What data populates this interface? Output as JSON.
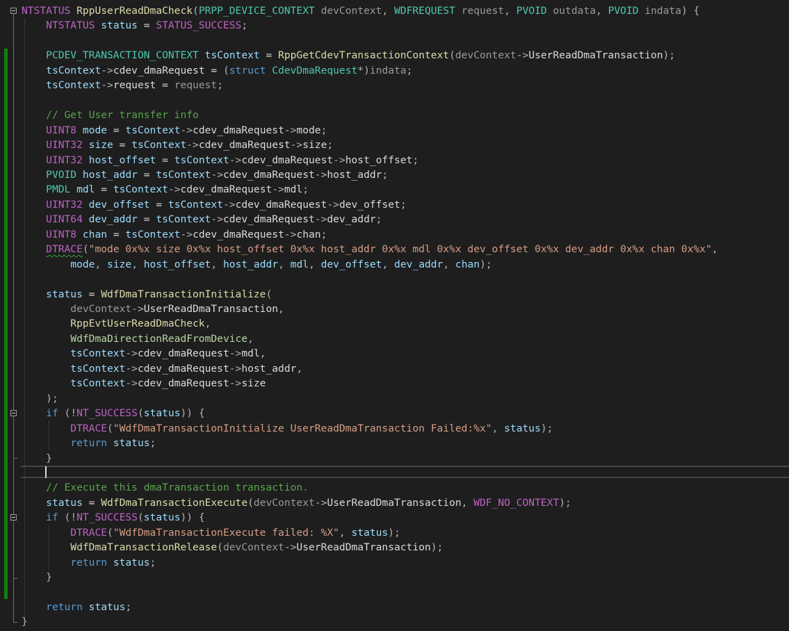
{
  "editor": {
    "colors": {
      "background": "#1e1e1e",
      "keyword": "#569cd6",
      "type": "#4ec9b0",
      "function": "#dcdcaa",
      "parameter": "#9a9a9a",
      "local": "#9cdcfe",
      "member": "#dadada",
      "string": "#d69d85",
      "comment": "#57a64a",
      "macro": "#bd63c5",
      "enum": "#b8d7a3",
      "changed_bar": "#108010"
    },
    "icons": [
      "fold-collapse-icon"
    ],
    "lines": [
      [
        [
          "ma",
          "NTSTATUS"
        ],
        [
          "tx",
          " "
        ],
        [
          "fn",
          "RppUserReadDmaCheck"
        ],
        [
          "op",
          "("
        ],
        [
          "ty",
          "PRPP_DEVICE_CONTEXT"
        ],
        [
          "tx",
          " "
        ],
        [
          "pa",
          "devContext"
        ],
        [
          "op",
          ", "
        ],
        [
          "ty",
          "WDFREQUEST"
        ],
        [
          "tx",
          " "
        ],
        [
          "pa",
          "request"
        ],
        [
          "op",
          ", "
        ],
        [
          "ty",
          "PVOID"
        ],
        [
          "tx",
          " "
        ],
        [
          "pa",
          "outdata"
        ],
        [
          "op",
          ", "
        ],
        [
          "ty",
          "PVOID"
        ],
        [
          "tx",
          " "
        ],
        [
          "pa",
          "indata"
        ],
        [
          "op",
          ") {"
        ]
      ],
      [
        [
          "tx",
          "    "
        ],
        [
          "ma",
          "NTSTATUS"
        ],
        [
          "tx",
          " "
        ],
        [
          "lv",
          "status"
        ],
        [
          "tx",
          " = "
        ],
        [
          "ma",
          "STATUS_SUCCESS"
        ],
        [
          "op",
          ";"
        ]
      ],
      [],
      [
        [
          "tx",
          "    "
        ],
        [
          "ty",
          "PCDEV_TRANSACTION_CONTEXT"
        ],
        [
          "tx",
          " "
        ],
        [
          "lv",
          "tsContext"
        ],
        [
          "tx",
          " = "
        ],
        [
          "fn",
          "RppGetCdevTransactionContext"
        ],
        [
          "op",
          "("
        ],
        [
          "pa",
          "devContext"
        ],
        [
          "op",
          "->"
        ],
        [
          "mb",
          "UserReadDmaTransaction"
        ],
        [
          "op",
          ");"
        ]
      ],
      [
        [
          "tx",
          "    "
        ],
        [
          "lv",
          "tsContext"
        ],
        [
          "op",
          "->"
        ],
        [
          "mb",
          "cdev_dmaRequest"
        ],
        [
          "tx",
          " = "
        ],
        [
          "op",
          "("
        ],
        [
          "kw",
          "struct"
        ],
        [
          "tx",
          " "
        ],
        [
          "ty",
          "CdevDmaRequest"
        ],
        [
          "op",
          "*)"
        ],
        [
          "pa",
          "indata"
        ],
        [
          "op",
          ";"
        ]
      ],
      [
        [
          "tx",
          "    "
        ],
        [
          "lv",
          "tsContext"
        ],
        [
          "op",
          "->"
        ],
        [
          "mb",
          "request"
        ],
        [
          "tx",
          " = "
        ],
        [
          "pa",
          "request"
        ],
        [
          "op",
          ";"
        ]
      ],
      [],
      [
        [
          "tx",
          "    "
        ],
        [
          "cm",
          "// Get User transfer info"
        ]
      ],
      [
        [
          "tx",
          "    "
        ],
        [
          "ma",
          "UINT8"
        ],
        [
          "tx",
          " "
        ],
        [
          "lv",
          "mode"
        ],
        [
          "tx",
          " = "
        ],
        [
          "lv",
          "tsContext"
        ],
        [
          "op",
          "->"
        ],
        [
          "mb",
          "cdev_dmaRequest"
        ],
        [
          "op",
          "->"
        ],
        [
          "mb",
          "mode"
        ],
        [
          "op",
          ";"
        ]
      ],
      [
        [
          "tx",
          "    "
        ],
        [
          "ma",
          "UINT32"
        ],
        [
          "tx",
          " "
        ],
        [
          "lv",
          "size"
        ],
        [
          "tx",
          " = "
        ],
        [
          "lv",
          "tsContext"
        ],
        [
          "op",
          "->"
        ],
        [
          "mb",
          "cdev_dmaRequest"
        ],
        [
          "op",
          "->"
        ],
        [
          "mb",
          "size"
        ],
        [
          "op",
          ";"
        ]
      ],
      [
        [
          "tx",
          "    "
        ],
        [
          "ma",
          "UINT32"
        ],
        [
          "tx",
          " "
        ],
        [
          "lv",
          "host_offset"
        ],
        [
          "tx",
          " = "
        ],
        [
          "lv",
          "tsContext"
        ],
        [
          "op",
          "->"
        ],
        [
          "mb",
          "cdev_dmaRequest"
        ],
        [
          "op",
          "->"
        ],
        [
          "mb",
          "host_offset"
        ],
        [
          "op",
          ";"
        ]
      ],
      [
        [
          "tx",
          "    "
        ],
        [
          "ty",
          "PVOID"
        ],
        [
          "tx",
          " "
        ],
        [
          "lv",
          "host_addr"
        ],
        [
          "tx",
          " = "
        ],
        [
          "lv",
          "tsContext"
        ],
        [
          "op",
          "->"
        ],
        [
          "mb",
          "cdev_dmaRequest"
        ],
        [
          "op",
          "->"
        ],
        [
          "mb",
          "host_addr"
        ],
        [
          "op",
          ";"
        ]
      ],
      [
        [
          "tx",
          "    "
        ],
        [
          "ty",
          "PMDL"
        ],
        [
          "tx",
          " "
        ],
        [
          "lv",
          "mdl"
        ],
        [
          "tx",
          " = "
        ],
        [
          "lv",
          "tsContext"
        ],
        [
          "op",
          "->"
        ],
        [
          "mb",
          "cdev_dmaRequest"
        ],
        [
          "op",
          "->"
        ],
        [
          "mb",
          "mdl"
        ],
        [
          "op",
          ";"
        ]
      ],
      [
        [
          "tx",
          "    "
        ],
        [
          "ma",
          "UINT32"
        ],
        [
          "tx",
          " "
        ],
        [
          "lv",
          "dev_offset"
        ],
        [
          "tx",
          " = "
        ],
        [
          "lv",
          "tsContext"
        ],
        [
          "op",
          "->"
        ],
        [
          "mb",
          "cdev_dmaRequest"
        ],
        [
          "op",
          "->"
        ],
        [
          "mb",
          "dev_offset"
        ],
        [
          "op",
          ";"
        ]
      ],
      [
        [
          "tx",
          "    "
        ],
        [
          "ma",
          "UINT64"
        ],
        [
          "tx",
          " "
        ],
        [
          "lv",
          "dev_addr"
        ],
        [
          "tx",
          " = "
        ],
        [
          "lv",
          "tsContext"
        ],
        [
          "op",
          "->"
        ],
        [
          "mb",
          "cdev_dmaRequest"
        ],
        [
          "op",
          "->"
        ],
        [
          "mb",
          "dev_addr"
        ],
        [
          "op",
          ";"
        ]
      ],
      [
        [
          "tx",
          "    "
        ],
        [
          "ma",
          "UINT8"
        ],
        [
          "tx",
          " "
        ],
        [
          "lv",
          "chan"
        ],
        [
          "tx",
          " = "
        ],
        [
          "lv",
          "tsContext"
        ],
        [
          "op",
          "->"
        ],
        [
          "mb",
          "cdev_dmaRequest"
        ],
        [
          "op",
          "->"
        ],
        [
          "mb",
          "chan"
        ],
        [
          "op",
          ";"
        ]
      ],
      [
        [
          "tx",
          "    "
        ],
        [
          "mq",
          "DTRACE"
        ],
        [
          "op",
          "("
        ],
        [
          "st",
          "\"mode 0x%x size 0x%x host_offset 0x%x host_addr 0x%x mdl 0x%x dev_offset 0x%x dev_addr 0x%x chan 0x%x\""
        ],
        [
          "op",
          ","
        ]
      ],
      [
        [
          "tx",
          "        "
        ],
        [
          "lv",
          "mode"
        ],
        [
          "op",
          ", "
        ],
        [
          "lv",
          "size"
        ],
        [
          "op",
          ", "
        ],
        [
          "lv",
          "host_offset"
        ],
        [
          "op",
          ", "
        ],
        [
          "lv",
          "host_addr"
        ],
        [
          "op",
          ", "
        ],
        [
          "lv",
          "mdl"
        ],
        [
          "op",
          ", "
        ],
        [
          "lv",
          "dev_offset"
        ],
        [
          "op",
          ", "
        ],
        [
          "lv",
          "dev_addr"
        ],
        [
          "op",
          ", "
        ],
        [
          "lv",
          "chan"
        ],
        [
          "op",
          ");"
        ]
      ],
      [],
      [
        [
          "tx",
          "    "
        ],
        [
          "lv",
          "status"
        ],
        [
          "tx",
          " = "
        ],
        [
          "fn",
          "WdfDmaTransactionInitialize"
        ],
        [
          "op",
          "("
        ]
      ],
      [
        [
          "tx",
          "        "
        ],
        [
          "pa",
          "devContext"
        ],
        [
          "op",
          "->"
        ],
        [
          "mb",
          "UserReadDmaTransaction"
        ],
        [
          "op",
          ","
        ]
      ],
      [
        [
          "tx",
          "        "
        ],
        [
          "fn",
          "RppEvtUserReadDmaCheck"
        ],
        [
          "op",
          ","
        ]
      ],
      [
        [
          "tx",
          "        "
        ],
        [
          "en",
          "WdfDmaDirectionReadFromDevice"
        ],
        [
          "op",
          ","
        ]
      ],
      [
        [
          "tx",
          "        "
        ],
        [
          "lv",
          "tsContext"
        ],
        [
          "op",
          "->"
        ],
        [
          "mb",
          "cdev_dmaRequest"
        ],
        [
          "op",
          "->"
        ],
        [
          "mb",
          "mdl"
        ],
        [
          "op",
          ","
        ]
      ],
      [
        [
          "tx",
          "        "
        ],
        [
          "lv",
          "tsContext"
        ],
        [
          "op",
          "->"
        ],
        [
          "mb",
          "cdev_dmaRequest"
        ],
        [
          "op",
          "->"
        ],
        [
          "mb",
          "host_addr"
        ],
        [
          "op",
          ","
        ]
      ],
      [
        [
          "tx",
          "        "
        ],
        [
          "lv",
          "tsContext"
        ],
        [
          "op",
          "->"
        ],
        [
          "mb",
          "cdev_dmaRequest"
        ],
        [
          "op",
          "->"
        ],
        [
          "mb",
          "size"
        ]
      ],
      [
        [
          "tx",
          "    "
        ],
        [
          "op",
          ");"
        ]
      ],
      [
        [
          "tx",
          "    "
        ],
        [
          "kw",
          "if"
        ],
        [
          "tx",
          " "
        ],
        [
          "op",
          "(!"
        ],
        [
          "ma",
          "NT_SUCCESS"
        ],
        [
          "op",
          "("
        ],
        [
          "lv",
          "status"
        ],
        [
          "op",
          "))"
        ],
        [
          "tx",
          " "
        ],
        [
          "op",
          "{"
        ]
      ],
      [
        [
          "tx",
          "        "
        ],
        [
          "ma",
          "DTRACE"
        ],
        [
          "op",
          "("
        ],
        [
          "st",
          "\"WdfDmaTransactionInitialize UserReadDmaTransaction Failed:%x\""
        ],
        [
          "op",
          ", "
        ],
        [
          "lv",
          "status"
        ],
        [
          "op",
          ");"
        ]
      ],
      [
        [
          "tx",
          "        "
        ],
        [
          "kw",
          "return"
        ],
        [
          "tx",
          " "
        ],
        [
          "lv",
          "status"
        ],
        [
          "op",
          ";"
        ]
      ],
      [
        [
          "tx",
          "    "
        ],
        [
          "op",
          "}"
        ]
      ],
      [],
      [
        [
          "tx",
          "    "
        ],
        [
          "cm",
          "// Execute this dmaTransaction transaction."
        ]
      ],
      [
        [
          "tx",
          "    "
        ],
        [
          "lv",
          "status"
        ],
        [
          "tx",
          " = "
        ],
        [
          "fn",
          "WdfDmaTransactionExecute"
        ],
        [
          "op",
          "("
        ],
        [
          "pa",
          "devContext"
        ],
        [
          "op",
          "->"
        ],
        [
          "mb",
          "UserReadDmaTransaction"
        ],
        [
          "op",
          ", "
        ],
        [
          "ma",
          "WDF_NO_CONTEXT"
        ],
        [
          "op",
          ");"
        ]
      ],
      [
        [
          "tx",
          "    "
        ],
        [
          "kw",
          "if"
        ],
        [
          "tx",
          " "
        ],
        [
          "op",
          "(!"
        ],
        [
          "ma",
          "NT_SUCCESS"
        ],
        [
          "op",
          "("
        ],
        [
          "lv",
          "status"
        ],
        [
          "op",
          "))"
        ],
        [
          "tx",
          " "
        ],
        [
          "op",
          "{"
        ]
      ],
      [
        [
          "tx",
          "        "
        ],
        [
          "ma",
          "DTRACE"
        ],
        [
          "op",
          "("
        ],
        [
          "st",
          "\"WdfDmaTransactionExecute failed: %X\""
        ],
        [
          "op",
          ", "
        ],
        [
          "lv",
          "status"
        ],
        [
          "op",
          ");"
        ]
      ],
      [
        [
          "tx",
          "        "
        ],
        [
          "fn",
          "WdfDmaTransactionRelease"
        ],
        [
          "op",
          "("
        ],
        [
          "pa",
          "devContext"
        ],
        [
          "op",
          "->"
        ],
        [
          "mb",
          "UserReadDmaTransaction"
        ],
        [
          "op",
          ");"
        ]
      ],
      [
        [
          "tx",
          "        "
        ],
        [
          "kw",
          "return"
        ],
        [
          "tx",
          " "
        ],
        [
          "lv",
          "status"
        ],
        [
          "op",
          ";"
        ]
      ],
      [
        [
          "tx",
          "    "
        ],
        [
          "op",
          "}"
        ]
      ],
      [],
      [
        [
          "tx",
          "    "
        ],
        [
          "kw",
          "return"
        ],
        [
          "tx",
          " "
        ],
        [
          "lv",
          "status"
        ],
        [
          "op",
          ";"
        ]
      ],
      [
        [
          "op",
          "}"
        ]
      ]
    ]
  }
}
